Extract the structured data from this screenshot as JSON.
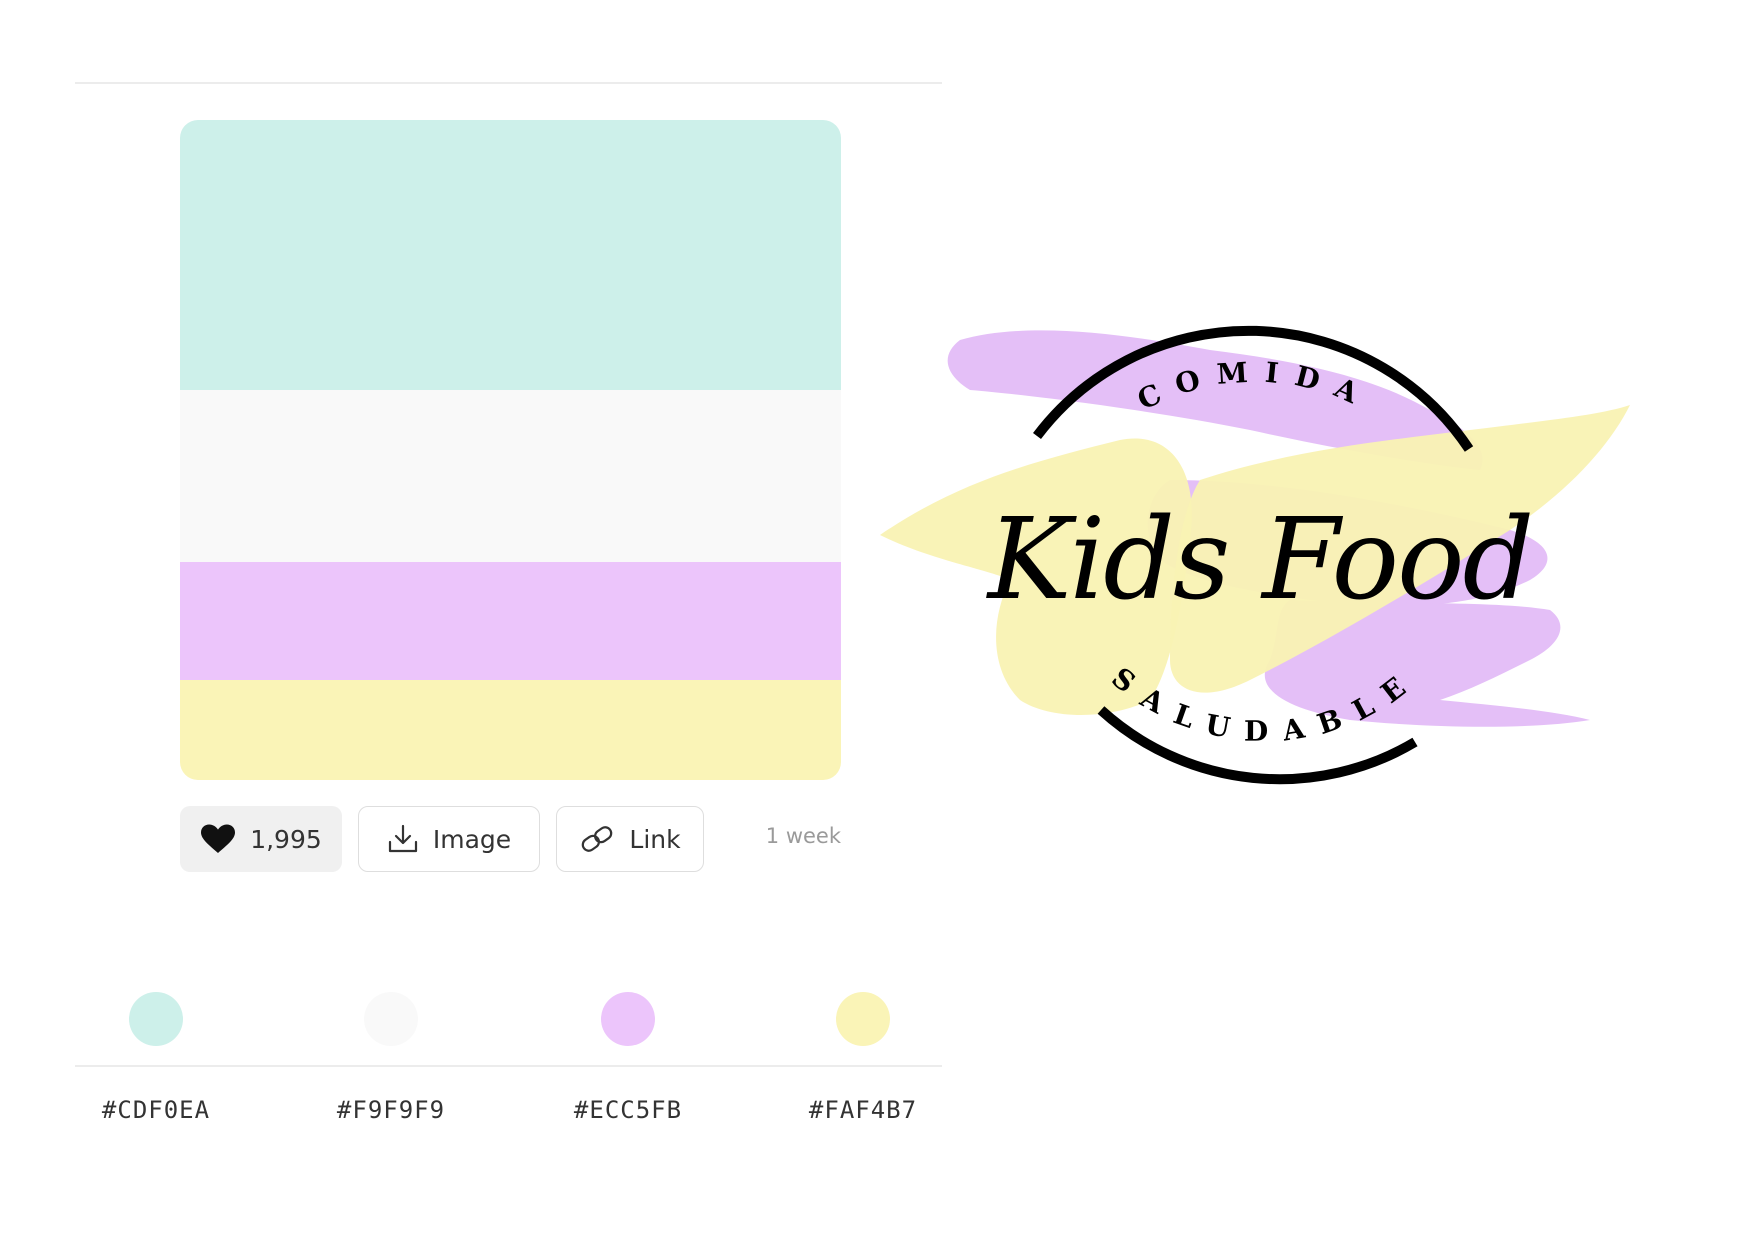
{
  "palette": {
    "colors": [
      {
        "hex": "#CDF0EA",
        "label": "#CDF0EA"
      },
      {
        "hex": "#F9F9F9",
        "label": "#F9F9F9"
      },
      {
        "hex": "#ECC5FB",
        "label": "#ECC5FB"
      },
      {
        "hex": "#FAF4B7",
        "label": "#FAF4B7"
      }
    ]
  },
  "actions": {
    "likes": "1,995",
    "image_label": "Image",
    "link_label": "Link",
    "time_ago": "1 week"
  },
  "icons": {
    "like": "heart-icon",
    "image": "download-icon",
    "link": "link-icon"
  },
  "logo": {
    "script_text": "Kids Food",
    "arc_top": "COMIDA",
    "arc_bottom": "SALUDABLE",
    "brush_colors": [
      "#E4BFF7",
      "#F9F2B3"
    ],
    "ring_color": "#000000"
  }
}
